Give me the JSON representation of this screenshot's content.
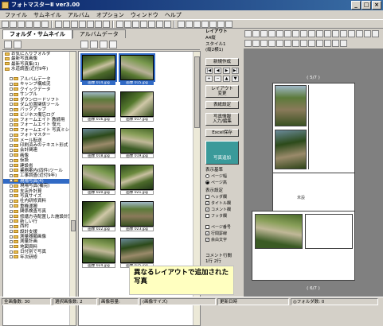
{
  "window": {
    "title": "フォトマスターⅡ  ver3.00",
    "controls": [
      "_",
      "□",
      "×"
    ]
  },
  "menu": [
    "ファイル",
    "サムネイル",
    "アルバム",
    "オプション",
    "ウィンドウ",
    "ヘルプ"
  ],
  "left_panel": {
    "tabs": [
      "フォルダ・サムネイル",
      "アルバムデータ"
    ],
    "tree": [
      {
        "label": "お気に入りフォルダ",
        "indent": false,
        "sel": false
      },
      {
        "label": "最新写真画像",
        "indent": false,
        "sel": false
      },
      {
        "label": "最新写真集(1)",
        "indent": false,
        "sel": false
      },
      {
        "label": "水道調査(近付9年)",
        "indent": false,
        "sel": false
      },
      {
        "label": "",
        "indent": false,
        "sel": false
      },
      {
        "label": "アルバムデータ",
        "indent": true,
        "sel": false
      },
      {
        "label": "キャンプ構成況",
        "indent": true,
        "sel": false
      },
      {
        "label": "クイックデータ",
        "indent": true,
        "sel": false
      },
      {
        "label": "サンプル",
        "indent": true,
        "sel": false
      },
      {
        "label": "ダウンロードソフト",
        "indent": true,
        "sel": false
      },
      {
        "label": "ダム位置関係ツール",
        "indent": true,
        "sel": false
      },
      {
        "label": "バックアップ",
        "indent": true,
        "sel": false
      },
      {
        "label": "ビジネス備忘ログ",
        "indent": true,
        "sel": false
      },
      {
        "label": "フォームエイト 教師用",
        "indent": true,
        "sel": false
      },
      {
        "label": "フォームエイト 復元",
        "indent": true,
        "sel": false
      },
      {
        "label": "フォームエイト 写真ミシル",
        "indent": true,
        "sel": false
      },
      {
        "label": "フォトマスター",
        "indent": true,
        "sel": false
      },
      {
        "label": "メール転送",
        "indent": true,
        "sel": false
      },
      {
        "label": "印刷済みのテキスト形式",
        "indent": true,
        "sel": false
      },
      {
        "label": "会計関連",
        "indent": true,
        "sel": false
      },
      {
        "label": "画像",
        "indent": true,
        "sel": false
      },
      {
        "label": "仮設",
        "indent": true,
        "sel": false
      },
      {
        "label": "建設省",
        "indent": true,
        "sel": false
      },
      {
        "label": "業務案内(四件)ツール",
        "indent": true,
        "sel": false
      },
      {
        "label": "工事調査(近付9年)",
        "indent": true,
        "sel": false
      },
      {
        "label": "現場写真(4)",
        "indent": true,
        "sel": true
      },
      {
        "label": "現場写真(補完)",
        "indent": true,
        "sel": false
      },
      {
        "label": "支店外計算",
        "indent": true,
        "sel": false
      },
      {
        "label": "写真サイズ",
        "indent": true,
        "sel": false
      },
      {
        "label": "社内研修資料",
        "indent": true,
        "sel": false
      },
      {
        "label": "重機運搬",
        "indent": true,
        "sel": false
      },
      {
        "label": "関係検査写真",
        "indent": true,
        "sel": false
      },
      {
        "label": "修繕方寺配置した施設計算",
        "indent": true,
        "sel": false
      },
      {
        "label": "新しい行",
        "indent": true,
        "sel": false
      },
      {
        "label": "西村",
        "indent": true,
        "sel": false
      },
      {
        "label": "設計支援",
        "indent": true,
        "sel": false
      },
      {
        "label": "測量器類画像",
        "indent": true,
        "sel": false
      },
      {
        "label": "測量計画",
        "indent": true,
        "sel": false
      },
      {
        "label": "地図資料",
        "indent": true,
        "sel": false
      },
      {
        "label": "日付別で写真",
        "indent": true,
        "sel": false
      },
      {
        "label": "年次研修",
        "indent": true,
        "sel": false
      }
    ],
    "thumbs": [
      {
        "cap": "画像 014.jpg",
        "sel": true,
        "cls": "forest1"
      },
      {
        "cap": "画像 015.jpg",
        "sel": true,
        "cls": "forest2"
      },
      {
        "cap": "画像 016.jpg",
        "sel": false,
        "cls": "forest3"
      },
      {
        "cap": "画像 017.jpg",
        "sel": false,
        "cls": "forest4"
      },
      {
        "cap": "画像 018.jpg",
        "sel": false,
        "cls": "forest5"
      },
      {
        "cap": "画像 019.jpg",
        "sel": false,
        "cls": "forest6"
      },
      {
        "cap": "画像 020.jpg",
        "sel": false,
        "cls": "forest2"
      },
      {
        "cap": "画像 021.jpg",
        "sel": false,
        "cls": "forest1"
      },
      {
        "cap": "画像 022.jpg",
        "sel": false,
        "cls": "forest4"
      },
      {
        "cap": "画像 023.jpg",
        "sel": false,
        "cls": "forest3"
      },
      {
        "cap": "画像 024.jpg",
        "sel": false,
        "cls": "forest6"
      },
      {
        "cap": "画像 025.jpg",
        "sel": false,
        "cls": "forest5"
      }
    ]
  },
  "controls": {
    "layout_label": "レイアウト",
    "paper": "A4縦",
    "style": "スタイル1\n(縦2横1)",
    "new_btn": "新規作成",
    "layout_btn": "レイアウト\n変更",
    "table_btn": "表紙設定",
    "info_btn": "写真情報\n入力/編集",
    "excel_btn": "Excel保存",
    "insert_btn": "写真追加",
    "display_label": "表示基準",
    "display_opts": [
      "ページ幅",
      "ページ高"
    ],
    "settings_label": "表示設定",
    "checks": [
      {
        "label": "ヘッダ欄",
        "on": false
      },
      {
        "label": "タイトル欄",
        "on": true
      },
      {
        "label": "コメント欄",
        "on": true
      },
      {
        "label": "フッタ欄",
        "on": false
      }
    ],
    "checks2": [
      {
        "label": "ページ番号",
        "on": false
      },
      {
        "label": "行間罫線",
        "on": true
      },
      {
        "label": "余白文字",
        "on": true
      }
    ],
    "comment_label": "コメント行間",
    "comment_opts": "1行  2行"
  },
  "preview": {
    "page1_label": "( 5/7 )",
    "page2_label": "( 6/7 )",
    "page1_caption": "未設",
    "page2_caption": ""
  },
  "callout": "異なるレイアウトで追加された写真",
  "status": [
    "全画像数: 30",
    "選択画像数: 2",
    "画像容量:",
    "(画像サイズ)",
    "更新日時",
    "◎フォルダ数: 0"
  ]
}
